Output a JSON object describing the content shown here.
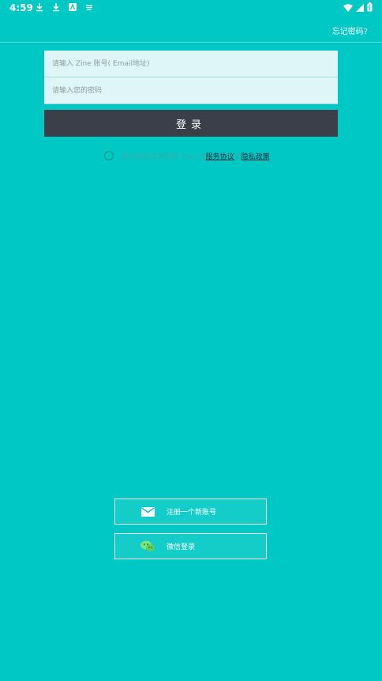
{
  "status_bar": {
    "time": "4:59"
  },
  "top_bar": {
    "forgot_password": "忘记密码?"
  },
  "form": {
    "account_placeholder": "请输入 Zine 账号( Email地址)",
    "password_placeholder": "请输入您的密码",
    "login_label": "登录"
  },
  "agreement": {
    "prefix": "我已经阅读并同意 Zine 的",
    "terms": "服务协议",
    "and": "和",
    "privacy": "隐私政策"
  },
  "alt_login": {
    "register_label": "注册一个新账号",
    "wechat_label": "微信登录"
  },
  "colors": {
    "background": "#00c8c4",
    "login_button": "#3a3f4a",
    "wechat_icon": "#7ee37e"
  },
  "icons": {
    "register": "mail-icon",
    "wechat": "wechat-icon"
  }
}
